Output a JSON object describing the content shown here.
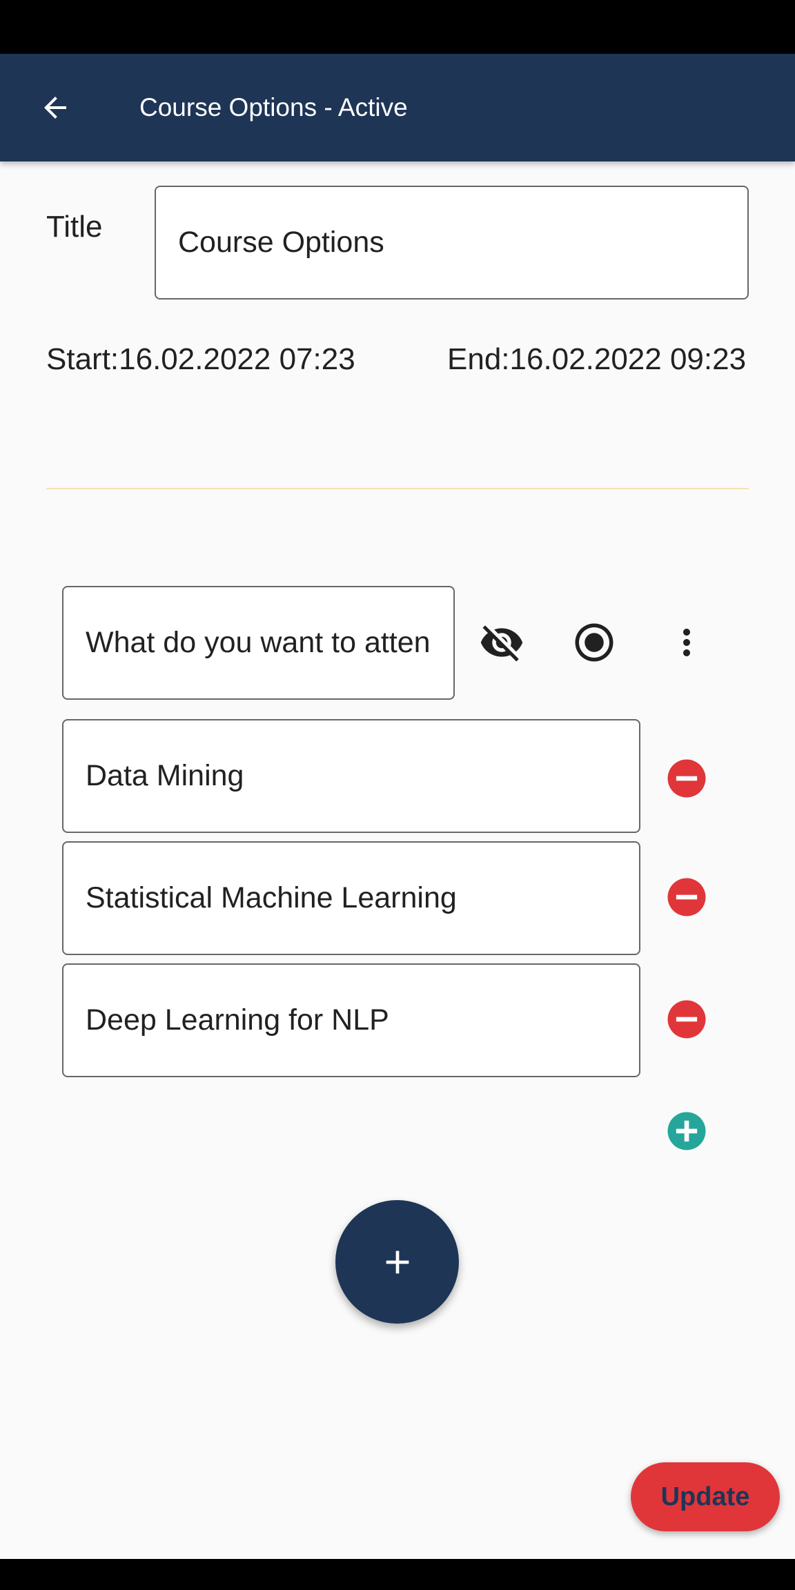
{
  "app_bar": {
    "title": "Course Options - Active",
    "back_icon": "arrow-left-icon"
  },
  "form": {
    "title_label": "Title",
    "title_value": "Course Options",
    "start_text": "Start:16.02.2022 07:23",
    "end_text": "End:16.02.2022 09:23"
  },
  "question": {
    "text": "What do you want to atten",
    "visibility_icon": "eye-off-icon",
    "type_icon": "radio-button-checked-icon",
    "menu_icon": "more-vert-icon"
  },
  "options": [
    {
      "value": "Data Mining",
      "remove_icon": "remove-circle-icon"
    },
    {
      "value": "Statistical Machine Learning",
      "remove_icon": "remove-circle-icon"
    },
    {
      "value": "Deep Learning for NLP",
      "remove_icon": "remove-circle-icon"
    }
  ],
  "add_option_icon": "add-circle-icon",
  "fab_icon": "plus-icon",
  "update_label": "Update",
  "colors": {
    "primary": "#1e3556",
    "danger": "#e0363a",
    "success": "#26a69a",
    "divider": "#f7dfb5"
  }
}
